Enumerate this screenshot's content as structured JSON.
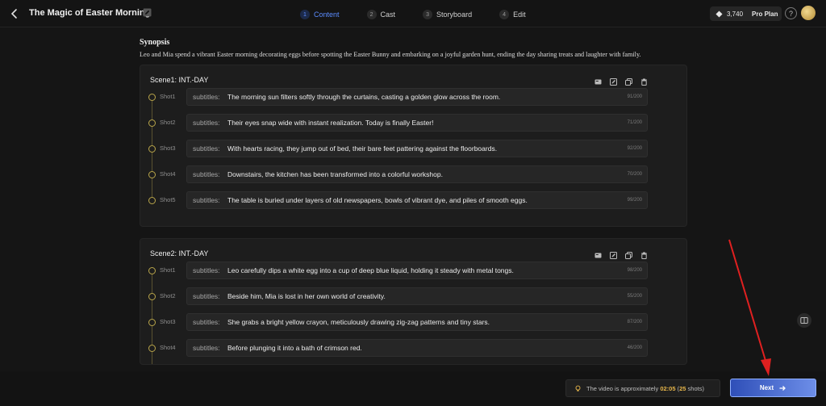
{
  "header": {
    "title": "The Magic of Easter Morning",
    "steps": [
      {
        "num": "1",
        "label": "Content"
      },
      {
        "num": "2",
        "label": "Cast"
      },
      {
        "num": "3",
        "label": "Storyboard"
      },
      {
        "num": "4",
        "label": "Edit"
      }
    ],
    "credits": "3,740",
    "plan": "Pro Plan",
    "help": "?"
  },
  "synopsis": {
    "heading": "Synopsis",
    "text": "Leo and Mia spend a vibrant Easter morning decorating eggs before spotting the Easter Bunny and embarking on a joyful garden hunt, ending the day sharing treats and laughter with family."
  },
  "scenes": [
    {
      "title": "Scene1: INT.-DAY",
      "shots": [
        {
          "label": "Shot1",
          "prefix": "subtitles:",
          "text": "The morning sun filters softly through the curtains, casting a golden glow across the room.",
          "count": "91/200"
        },
        {
          "label": "Shot2",
          "prefix": "subtitles:",
          "text": "Their eyes snap wide with instant realization. Today is finally Easter!",
          "count": "71/200"
        },
        {
          "label": "Shot3",
          "prefix": "subtitles:",
          "text": "With hearts racing, they jump out of bed, their bare feet pattering against the floorboards.",
          "count": "92/200"
        },
        {
          "label": "Shot4",
          "prefix": "subtitles:",
          "text": "Downstairs, the kitchen has been transformed into a colorful workshop.",
          "count": "70/200"
        },
        {
          "label": "Shot5",
          "prefix": "subtitles:",
          "text": "The table is buried under layers of old newspapers, bowls of vibrant dye, and piles of smooth eggs.",
          "count": "99/200"
        }
      ]
    },
    {
      "title": "Scene2: INT.-DAY",
      "shots": [
        {
          "label": "Shot1",
          "prefix": "subtitles:",
          "text": "Leo carefully dips a white egg into a cup of deep blue liquid, holding it steady with metal tongs.",
          "count": "98/200"
        },
        {
          "label": "Shot2",
          "prefix": "subtitles:",
          "text": "Beside him, Mia is lost in her own world of creativity.",
          "count": "55/200"
        },
        {
          "label": "Shot3",
          "prefix": "subtitles:",
          "text": "She grabs a bright yellow crayon, meticulously drawing zig-zag patterns and tiny stars.",
          "count": "87/200"
        },
        {
          "label": "Shot4",
          "prefix": "subtitles:",
          "text": "Before plunging it into a bath of crimson red.",
          "count": "46/200"
        }
      ]
    }
  ],
  "footer": {
    "estimate_prefix": "The video is approximately",
    "duration": "02:05",
    "shots_open": "(",
    "shots_count": "25",
    "shots_suffix": "shots)",
    "next_label": "Next"
  },
  "colors": {
    "accent": "#5b8cff",
    "highlight": "#e7b64a",
    "annotation_arrow": "#e02020"
  },
  "icons": [
    "back-arrow-icon",
    "edit-icon",
    "diamond-icon",
    "help-icon",
    "avatar",
    "card-icon",
    "edit-icon",
    "copy-icon",
    "trash-icon",
    "bulb-icon",
    "arrow-right-icon"
  ]
}
